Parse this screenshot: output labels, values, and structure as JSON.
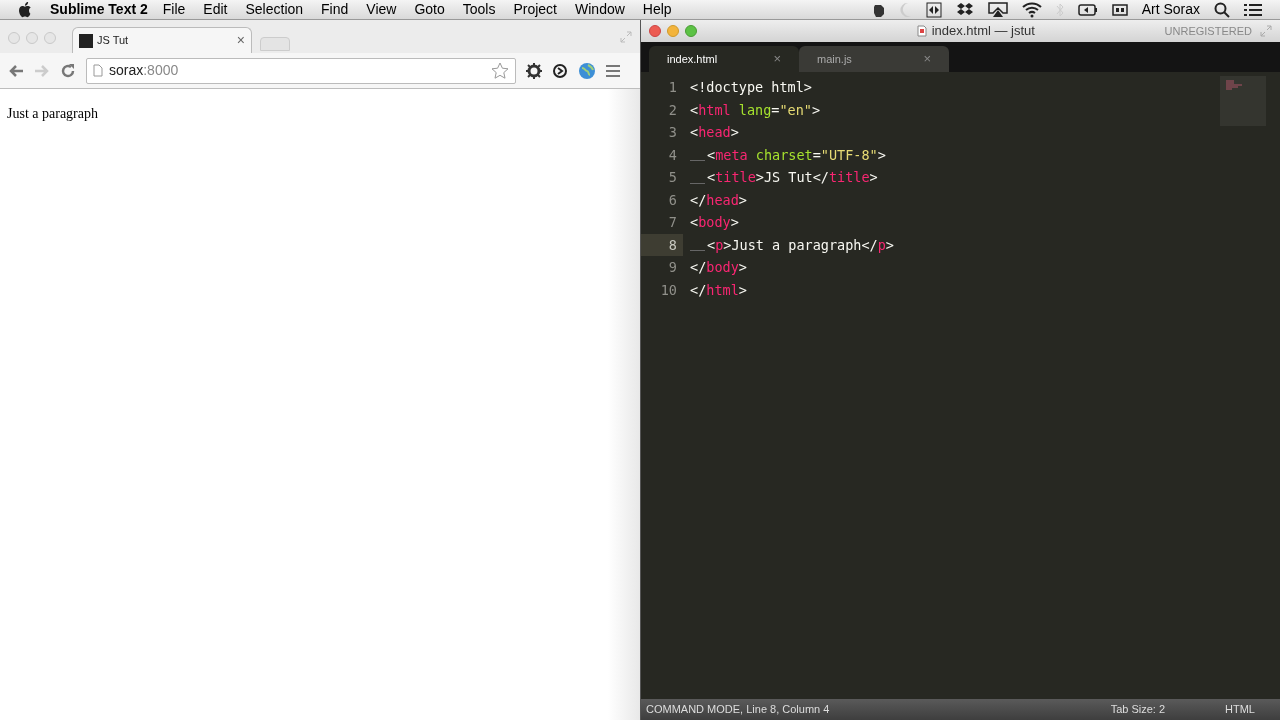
{
  "menu_bar": {
    "app": "Sublime Text 2",
    "menus": [
      "File",
      "Edit",
      "Selection",
      "Find",
      "View",
      "Goto",
      "Tools",
      "Project",
      "Window",
      "Help"
    ],
    "user": "Art Sorax"
  },
  "browser": {
    "tabs": [
      {
        "label": "JS Tut",
        "selected": true,
        "close": "×"
      }
    ],
    "address": {
      "host": "sorax",
      "port": ":8000"
    },
    "page_text": "Just a paragraph"
  },
  "editor": {
    "title": "index.html — jstut",
    "badge": "UNREGISTERED",
    "tabs": [
      {
        "label": "index.html",
        "selected": true,
        "close": "×"
      },
      {
        "label": "main.js",
        "selected": false,
        "close": "×"
      }
    ],
    "lines": [
      {
        "number": "1",
        "indent": false,
        "current": false,
        "tokens": [
          {
            "kind": "punct",
            "text": "<!doctype html>"
          }
        ]
      },
      {
        "number": "2",
        "indent": false,
        "current": false,
        "tokens": [
          {
            "kind": "punct",
            "text": "<"
          },
          {
            "kind": "tag",
            "text": "html"
          },
          {
            "kind": "attr",
            "text": " lang"
          },
          {
            "kind": "punct",
            "text": "="
          },
          {
            "kind": "string",
            "text": "\"en\""
          },
          {
            "kind": "punct",
            "text": ">"
          }
        ]
      },
      {
        "number": "3",
        "indent": false,
        "current": false,
        "tokens": [
          {
            "kind": "punct",
            "text": "<"
          },
          {
            "kind": "tag",
            "text": "head"
          },
          {
            "kind": "punct",
            "text": ">"
          }
        ]
      },
      {
        "number": "4",
        "indent": true,
        "current": false,
        "tokens": [
          {
            "kind": "punct",
            "text": "<"
          },
          {
            "kind": "tag",
            "text": "meta"
          },
          {
            "kind": "attr",
            "text": " charset"
          },
          {
            "kind": "punct",
            "text": "="
          },
          {
            "kind": "string",
            "text": "\"UTF-8\""
          },
          {
            "kind": "punct",
            "text": ">"
          }
        ]
      },
      {
        "number": "5",
        "indent": true,
        "current": false,
        "tokens": [
          {
            "kind": "punct",
            "text": "<"
          },
          {
            "kind": "tag",
            "text": "title"
          },
          {
            "kind": "punct",
            "text": ">JS Tut</"
          },
          {
            "kind": "tag",
            "text": "title"
          },
          {
            "kind": "punct",
            "text": ">"
          }
        ]
      },
      {
        "number": "6",
        "indent": false,
        "current": false,
        "tokens": [
          {
            "kind": "punct",
            "text": "</"
          },
          {
            "kind": "tag",
            "text": "head"
          },
          {
            "kind": "punct",
            "text": ">"
          }
        ]
      },
      {
        "number": "7",
        "indent": false,
        "current": false,
        "tokens": [
          {
            "kind": "punct",
            "text": "<"
          },
          {
            "kind": "tag",
            "text": "body"
          },
          {
            "kind": "punct",
            "text": ">"
          }
        ]
      },
      {
        "number": "8",
        "indent": true,
        "current": true,
        "tokens": [
          {
            "kind": "punct",
            "text": "<"
          },
          {
            "kind": "tag",
            "text": "p"
          },
          {
            "kind": "punct",
            "text": ">Just a paragraph</"
          },
          {
            "kind": "tag",
            "text": "p"
          },
          {
            "kind": "punct",
            "text": ">"
          }
        ]
      },
      {
        "number": "9",
        "indent": false,
        "current": false,
        "tokens": [
          {
            "kind": "punct",
            "text": "</"
          },
          {
            "kind": "tag",
            "text": "body"
          },
          {
            "kind": "punct",
            "text": ">"
          }
        ]
      },
      {
        "number": "10",
        "indent": false,
        "current": false,
        "tokens": [
          {
            "kind": "punct",
            "text": "</"
          },
          {
            "kind": "tag",
            "text": "html"
          },
          {
            "kind": "punct",
            "text": ">"
          }
        ]
      }
    ],
    "status_bar": {
      "mode": "COMMAND MODE, Line 8, Column 4",
      "tab_size": "Tab Size: 2",
      "syntax": "HTML"
    }
  }
}
